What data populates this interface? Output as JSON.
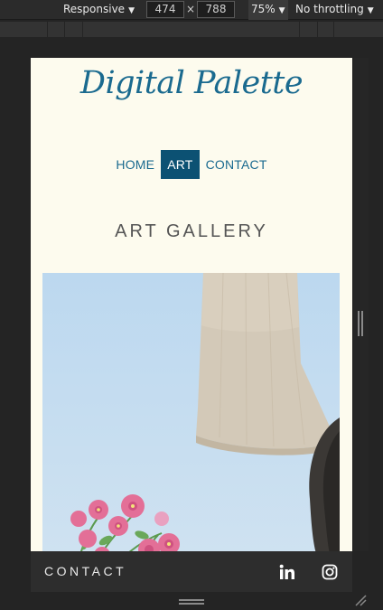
{
  "devtools": {
    "device_mode": "Responsive",
    "width_value": "474",
    "height_value": "788",
    "times_sign": "×",
    "zoom": "75%",
    "throttling": "No throttling",
    "arrow": "▼"
  },
  "site": {
    "logo": "Digital Palette",
    "nav": [
      {
        "label": "HOME",
        "active": false
      },
      {
        "label": "ART",
        "active": true
      },
      {
        "label": "CONTACT",
        "active": false
      }
    ],
    "gallery_title": "ART GALLERY",
    "footer": {
      "title": "CONTACT",
      "icons": [
        "linkedin-icon",
        "instagram-icon"
      ]
    }
  },
  "colors": {
    "page_background": "#fdfbee",
    "brand_blue": "#1a6a8f",
    "nav_active_bg": "#0c5173",
    "footer_bg": "#2d2d2d",
    "devtools_bg": "#242424"
  }
}
